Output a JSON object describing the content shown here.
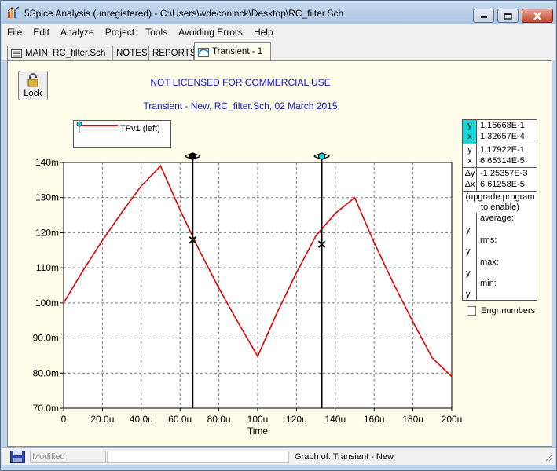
{
  "window": {
    "title": "5Spice Analysis (unregistered) - C:\\Users\\wdeconinck\\Desktop\\RC_filter.Sch",
    "icons": {
      "app": "5spice-app-icon",
      "minimize": "minimize-icon",
      "maximize": "maximize-icon",
      "close": "close-icon"
    }
  },
  "menu": [
    "File",
    "Edit",
    "Analyze",
    "Project",
    "Tools",
    "Avoiding Errors",
    "Help"
  ],
  "tabs": [
    {
      "label": "MAIN:  RC_filter.Sch",
      "icon": "schematic-icon",
      "active": false
    },
    {
      "label": "NOTES",
      "active": false
    },
    {
      "label": "REPORTS",
      "active": false
    },
    {
      "label": "Transient - 1",
      "icon": "graph-icon",
      "active": true
    }
  ],
  "lock_button": {
    "label": "Lock",
    "icon": "padlock-icon"
  },
  "banner": {
    "license": "NOT LICENSED FOR COMMERCIAL USE",
    "subtitle": "Transient - New,    RC_filter.Sch,   02 March 2015"
  },
  "legend": {
    "label": "TPv1 (left)"
  },
  "cursor_markers": [
    "<o>",
    "<o>"
  ],
  "chart_data": {
    "type": "line",
    "title": "",
    "xlabel": "Time",
    "ylabel": "",
    "xlim": [
      0,
      200
    ],
    "ylim": [
      70,
      140
    ],
    "x_ticks": [
      "0",
      "20.0u",
      "40.0u",
      "60.0u",
      "80.0u",
      "100u",
      "120u",
      "140u",
      "160u",
      "180u",
      "200u"
    ],
    "y_ticks": [
      "70.0m",
      "80.0m",
      "90.0m",
      "100m",
      "110m",
      "120m",
      "130m",
      "140m"
    ],
    "grid": true,
    "series": [
      {
        "name": "TPv1 (left)",
        "color": "#e60000",
        "x": [
          0,
          10,
          20,
          30,
          40,
          50,
          60,
          70,
          80,
          90,
          100,
          110,
          120,
          130,
          140,
          150,
          160,
          170,
          180,
          190,
          200
        ],
        "y": [
          100.0,
          109.2,
          117.8,
          125.8,
          133.3,
          139.0,
          126.5,
          114.9,
          104.2,
          94.3,
          84.8,
          97.2,
          108.6,
          119.1,
          125.5,
          130.0,
          117.2,
          105.5,
          94.6,
          84.3,
          79.0
        ]
      }
    ],
    "cursors": [
      {
        "x": 66.5,
        "y": 117.9,
        "head": "filled"
      },
      {
        "x": 133.0,
        "y": 116.7,
        "head": "hollow"
      }
    ]
  },
  "cursor_panel": {
    "c1_y_label": "y",
    "c1_y": "1.16668E-1",
    "c1_x_label": "x",
    "c1_x": "1.32657E-4",
    "c2_y_label": "y",
    "c2_y": "1.17922E-1",
    "c2_x_label": "x",
    "c2_x": "6.65314E-5",
    "dy_label": "Δy",
    "dy": "-1.25357E-3",
    "dx_label": "Δx",
    "dx": "6.61258E-5",
    "note_line1": "(upgrade program",
    "note_line2": "to enable)",
    "stats": [
      "average:",
      "rms:",
      "max:",
      "min:"
    ],
    "stat_y": "y",
    "highlight_color": "#19d6da"
  },
  "engr_checkbox": {
    "label": "Engr numbers",
    "checked": false
  },
  "statusbar": {
    "modified": "Modified",
    "graph_of": "Graph of:  Transient - New",
    "icon": "save-disk-icon"
  }
}
